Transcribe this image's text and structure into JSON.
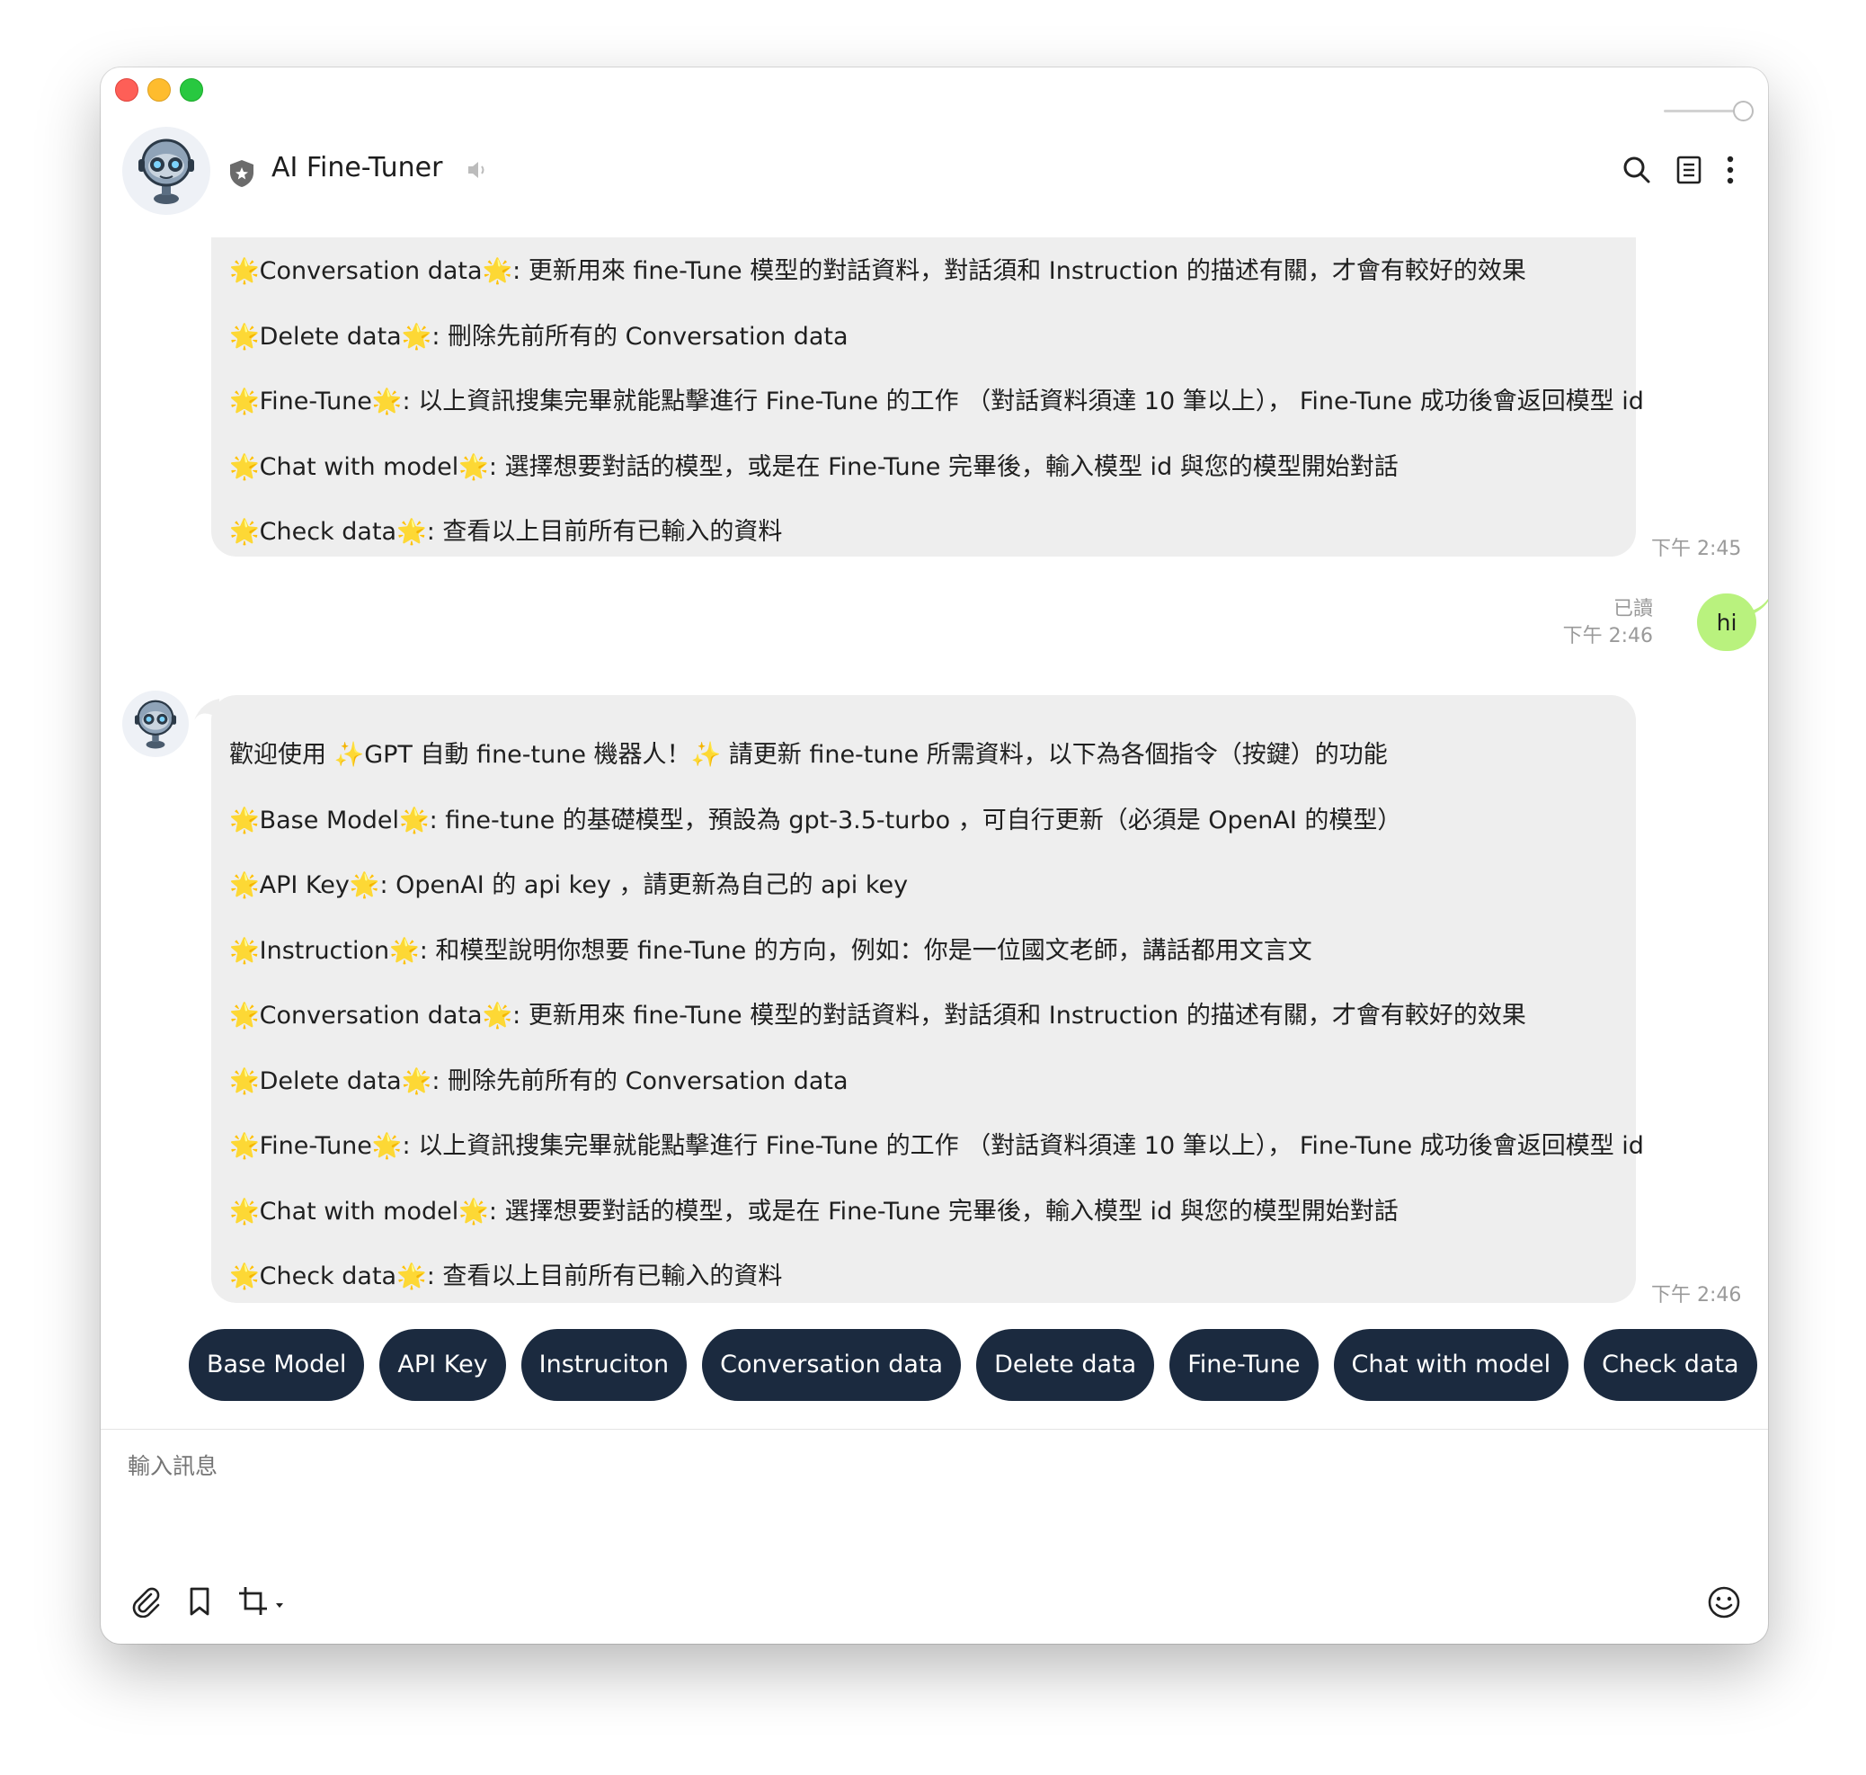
{
  "window": {
    "title": "AI Fine-Tuner"
  },
  "header": {
    "icons": [
      "bot-avatar",
      "shield-icon",
      "mute-icon",
      "search-icon",
      "notes-icon",
      "more-icon"
    ]
  },
  "messages": [
    {
      "sender": "bot",
      "lines": [
        "🌟Conversation data🌟: 更新用來 fine-Tune 模型的對話資料，對話須和 Instruction 的描述有關，才會有較好的效果",
        "🌟Delete data🌟: 刪除先前所有的 Conversation data",
        "🌟Fine-Tune🌟: 以上資訊搜集完畢就能點擊進行 Fine-Tune 的工作 （對話資料須達 10 筆以上）， Fine-Tune 成功後會返回模型 id",
        "🌟Chat with model🌟: 選擇想要對話的模型，或是在 Fine-Tune 完畢後，輸入模型 id 與您的模型開始對話",
        "🌟Check data🌟: 查看以上目前所有已輸入的資料"
      ],
      "time": "下午 2:45"
    },
    {
      "sender": "user",
      "text": "hi",
      "read": "已讀",
      "time": "下午 2:46"
    },
    {
      "sender": "bot",
      "lines": [
        "歡迎使用 ✨GPT 自動 fine-tune 機器人！✨ 請更新 fine-tune 所需資料，以下為各個指令（按鍵）的功能",
        "🌟Base Model🌟: fine-tune 的基礎模型，預設為 gpt-3.5-turbo ，可自行更新（必須是 OpenAI 的模型）",
        "🌟API Key🌟: OpenAI 的 api key ，請更新為自己的 api key",
        "🌟Instruction🌟: 和模型說明你想要 fine-Tune 的方向，例如：你是一位國文老師，講話都用文言文",
        "🌟Conversation data🌟: 更新用來 fine-Tune 模型的對話資料，對話須和 Instruction 的描述有關，才會有較好的效果",
        "🌟Delete data🌟: 刪除先前所有的 Conversation data",
        "🌟Fine-Tune🌟: 以上資訊搜集完畢就能點擊進行 Fine-Tune 的工作 （對話資料須達 10 筆以上）， Fine-Tune 成功後會返回模型 id",
        "🌟Chat with model🌟: 選擇想要對話的模型，或是在 Fine-Tune 完畢後，輸入模型 id 與您的模型開始對話",
        "🌟Check data🌟: 查看以上目前所有已輸入的資料"
      ],
      "time": "下午 2:46"
    }
  ],
  "quick_replies": [
    "Base Model",
    "API Key",
    "Instruciton",
    "Conversation data",
    "Delete data",
    "Fine-Tune",
    "Chat with model",
    "Check data"
  ],
  "composer": {
    "placeholder": "輸入訊息",
    "tools": [
      "paperclip-icon",
      "bookmark-icon",
      "crop-icon",
      "emoji-icon"
    ]
  },
  "colors": {
    "bot_bubble": "#eeeeee",
    "user_bubble": "#b9f27e",
    "quick_reply_bg": "#1b2a3f",
    "quick_reply_text": "#ffffff"
  }
}
